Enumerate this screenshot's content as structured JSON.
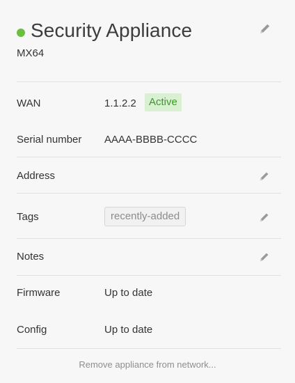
{
  "header": {
    "title": "Security Appliance",
    "model": "MX64",
    "status_color": "#6bbf3e",
    "edit_icon": "pencil-icon"
  },
  "details": {
    "wan": {
      "label": "WAN",
      "value": "1.1.2.2",
      "status": "Active",
      "status_color": "#3a9a26"
    },
    "serial": {
      "label": "Serial number",
      "value": "AAAA-BBBB-CCCC"
    },
    "address": {
      "label": "Address",
      "value": "",
      "edit_icon": "pencil-icon"
    },
    "tags": {
      "label": "Tags",
      "value": "recently-added",
      "edit_icon": "pencil-icon"
    },
    "notes": {
      "label": "Notes",
      "value": "",
      "edit_icon": "pencil-icon"
    },
    "firmware": {
      "label": "Firmware",
      "value": "Up to date"
    },
    "config": {
      "label": "Config",
      "value": "Up to date"
    }
  },
  "footer": {
    "remove_label": "Remove appliance from network..."
  }
}
